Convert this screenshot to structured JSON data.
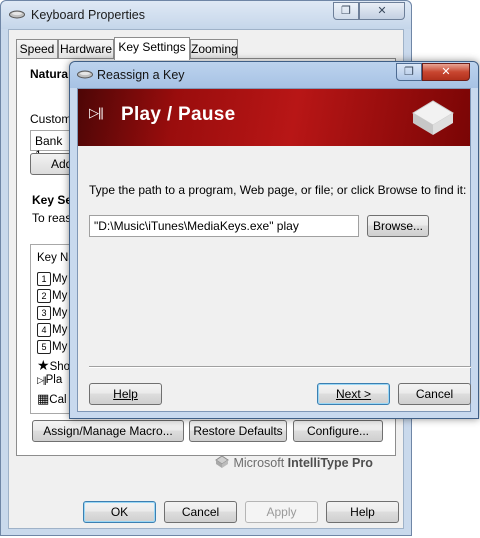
{
  "back_window": {
    "title": "Keyboard Properties",
    "tabs": [
      {
        "label": "Speed"
      },
      {
        "label": "Hardware"
      },
      {
        "label": "Key Settings"
      },
      {
        "label": "Zooming"
      }
    ],
    "natural_label": "Natura",
    "custom_label": "Custom",
    "bank_value": "Bank 1",
    "add_button": "Add",
    "key_settings_label": "Key Se",
    "to_reassign_text": "To reas",
    "key_list_header": "Key Na",
    "key_list": [
      {
        "badge": "1",
        "text": "My"
      },
      {
        "badge": "2",
        "text": "My"
      },
      {
        "badge": "3",
        "text": "My"
      },
      {
        "badge": "4",
        "text": "My"
      },
      {
        "badge": "5",
        "text": "My"
      },
      {
        "badge": "★",
        "text": "Sho"
      },
      {
        "badge": "▷||",
        "text": "Pla"
      },
      {
        "badge": "▦",
        "text": "Cal"
      }
    ],
    "buttons": {
      "assign_macro": "Assign/Manage Macro...",
      "restore_defaults": "Restore Defaults",
      "configure": "Configure..."
    },
    "logo": {
      "brand": "Microsoft",
      "product": "IntelliType",
      "edition": "Pro"
    },
    "bottom_buttons": {
      "ok": "OK",
      "cancel": "Cancel",
      "apply": "Apply",
      "help": "Help"
    }
  },
  "dialog": {
    "title": "Reassign a Key",
    "banner_title": "Play / Pause",
    "banner_glyph": "▷||",
    "instructions": "Type the path to a program, Web page, or file; or click Browse to find it:",
    "path_value": "\"D:\\Music\\iTunes\\MediaKeys.exe\" play",
    "browse_button": "Browse...",
    "help_button": "Help",
    "next_button": "Next >",
    "cancel_button": "Cancel"
  },
  "colors": {
    "banner_red": "#b81616",
    "title_bar_blue": "#bcd3ee"
  }
}
